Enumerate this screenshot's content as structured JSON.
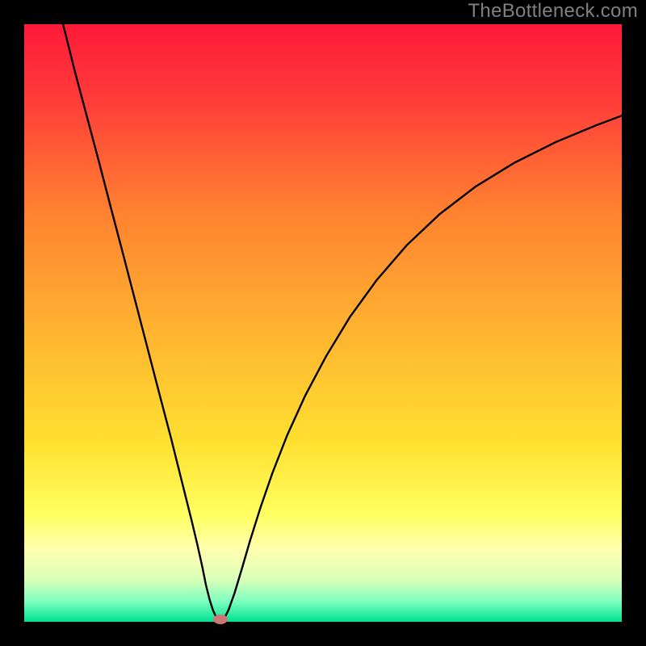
{
  "watermark": "TheBottleneck.com",
  "chart_data": {
    "type": "line",
    "title": "",
    "xlabel": "",
    "ylabel": "",
    "xlim": [
      0,
      1
    ],
    "ylim": [
      0,
      1
    ],
    "background_gradient": {
      "stops": [
        {
          "offset": 0.0,
          "color": "#ff1a3a"
        },
        {
          "offset": 0.12,
          "color": "#ff3a3a"
        },
        {
          "offset": 0.31,
          "color": "#ff8030"
        },
        {
          "offset": 0.5,
          "color": "#ffb030"
        },
        {
          "offset": 0.7,
          "color": "#ffe030"
        },
        {
          "offset": 0.82,
          "color": "#ffff60"
        },
        {
          "offset": 0.88,
          "color": "#ffffb0"
        },
        {
          "offset": 0.93,
          "color": "#d8ffb8"
        },
        {
          "offset": 0.965,
          "color": "#80ffc0"
        },
        {
          "offset": 1.0,
          "color": "#00e090"
        }
      ]
    },
    "series": [
      {
        "name": "bottleneck-curve",
        "color": "#000000",
        "stroke_width": 2.4,
        "points": [
          {
            "x": 0.065,
            "y": 1.0
          },
          {
            "x": 0.085,
            "y": 0.92
          },
          {
            "x": 0.105,
            "y": 0.845
          },
          {
            "x": 0.125,
            "y": 0.77
          },
          {
            "x": 0.145,
            "y": 0.693
          },
          {
            "x": 0.165,
            "y": 0.617
          },
          {
            "x": 0.185,
            "y": 0.54
          },
          {
            "x": 0.205,
            "y": 0.463
          },
          {
            "x": 0.225,
            "y": 0.386
          },
          {
            "x": 0.245,
            "y": 0.31
          },
          {
            "x": 0.26,
            "y": 0.25
          },
          {
            "x": 0.27,
            "y": 0.21
          },
          {
            "x": 0.28,
            "y": 0.17
          },
          {
            "x": 0.29,
            "y": 0.128
          },
          {
            "x": 0.298,
            "y": 0.092
          },
          {
            "x": 0.304,
            "y": 0.062
          },
          {
            "x": 0.31,
            "y": 0.038
          },
          {
            "x": 0.316,
            "y": 0.019
          },
          {
            "x": 0.322,
            "y": 0.006
          },
          {
            "x": 0.328,
            "y": 0.0
          },
          {
            "x": 0.334,
            "y": 0.004
          },
          {
            "x": 0.342,
            "y": 0.02
          },
          {
            "x": 0.352,
            "y": 0.048
          },
          {
            "x": 0.364,
            "y": 0.088
          },
          {
            "x": 0.378,
            "y": 0.136
          },
          {
            "x": 0.395,
            "y": 0.19
          },
          {
            "x": 0.415,
            "y": 0.248
          },
          {
            "x": 0.44,
            "y": 0.312
          },
          {
            "x": 0.47,
            "y": 0.378
          },
          {
            "x": 0.505,
            "y": 0.444
          },
          {
            "x": 0.545,
            "y": 0.51
          },
          {
            "x": 0.59,
            "y": 0.572
          },
          {
            "x": 0.64,
            "y": 0.63
          },
          {
            "x": 0.695,
            "y": 0.682
          },
          {
            "x": 0.755,
            "y": 0.728
          },
          {
            "x": 0.82,
            "y": 0.768
          },
          {
            "x": 0.89,
            "y": 0.803
          },
          {
            "x": 0.96,
            "y": 0.832
          },
          {
            "x": 1.0,
            "y": 0.847
          }
        ]
      }
    ],
    "marker": {
      "x": 0.328,
      "y": 0.004,
      "color": "#cc7777"
    }
  }
}
